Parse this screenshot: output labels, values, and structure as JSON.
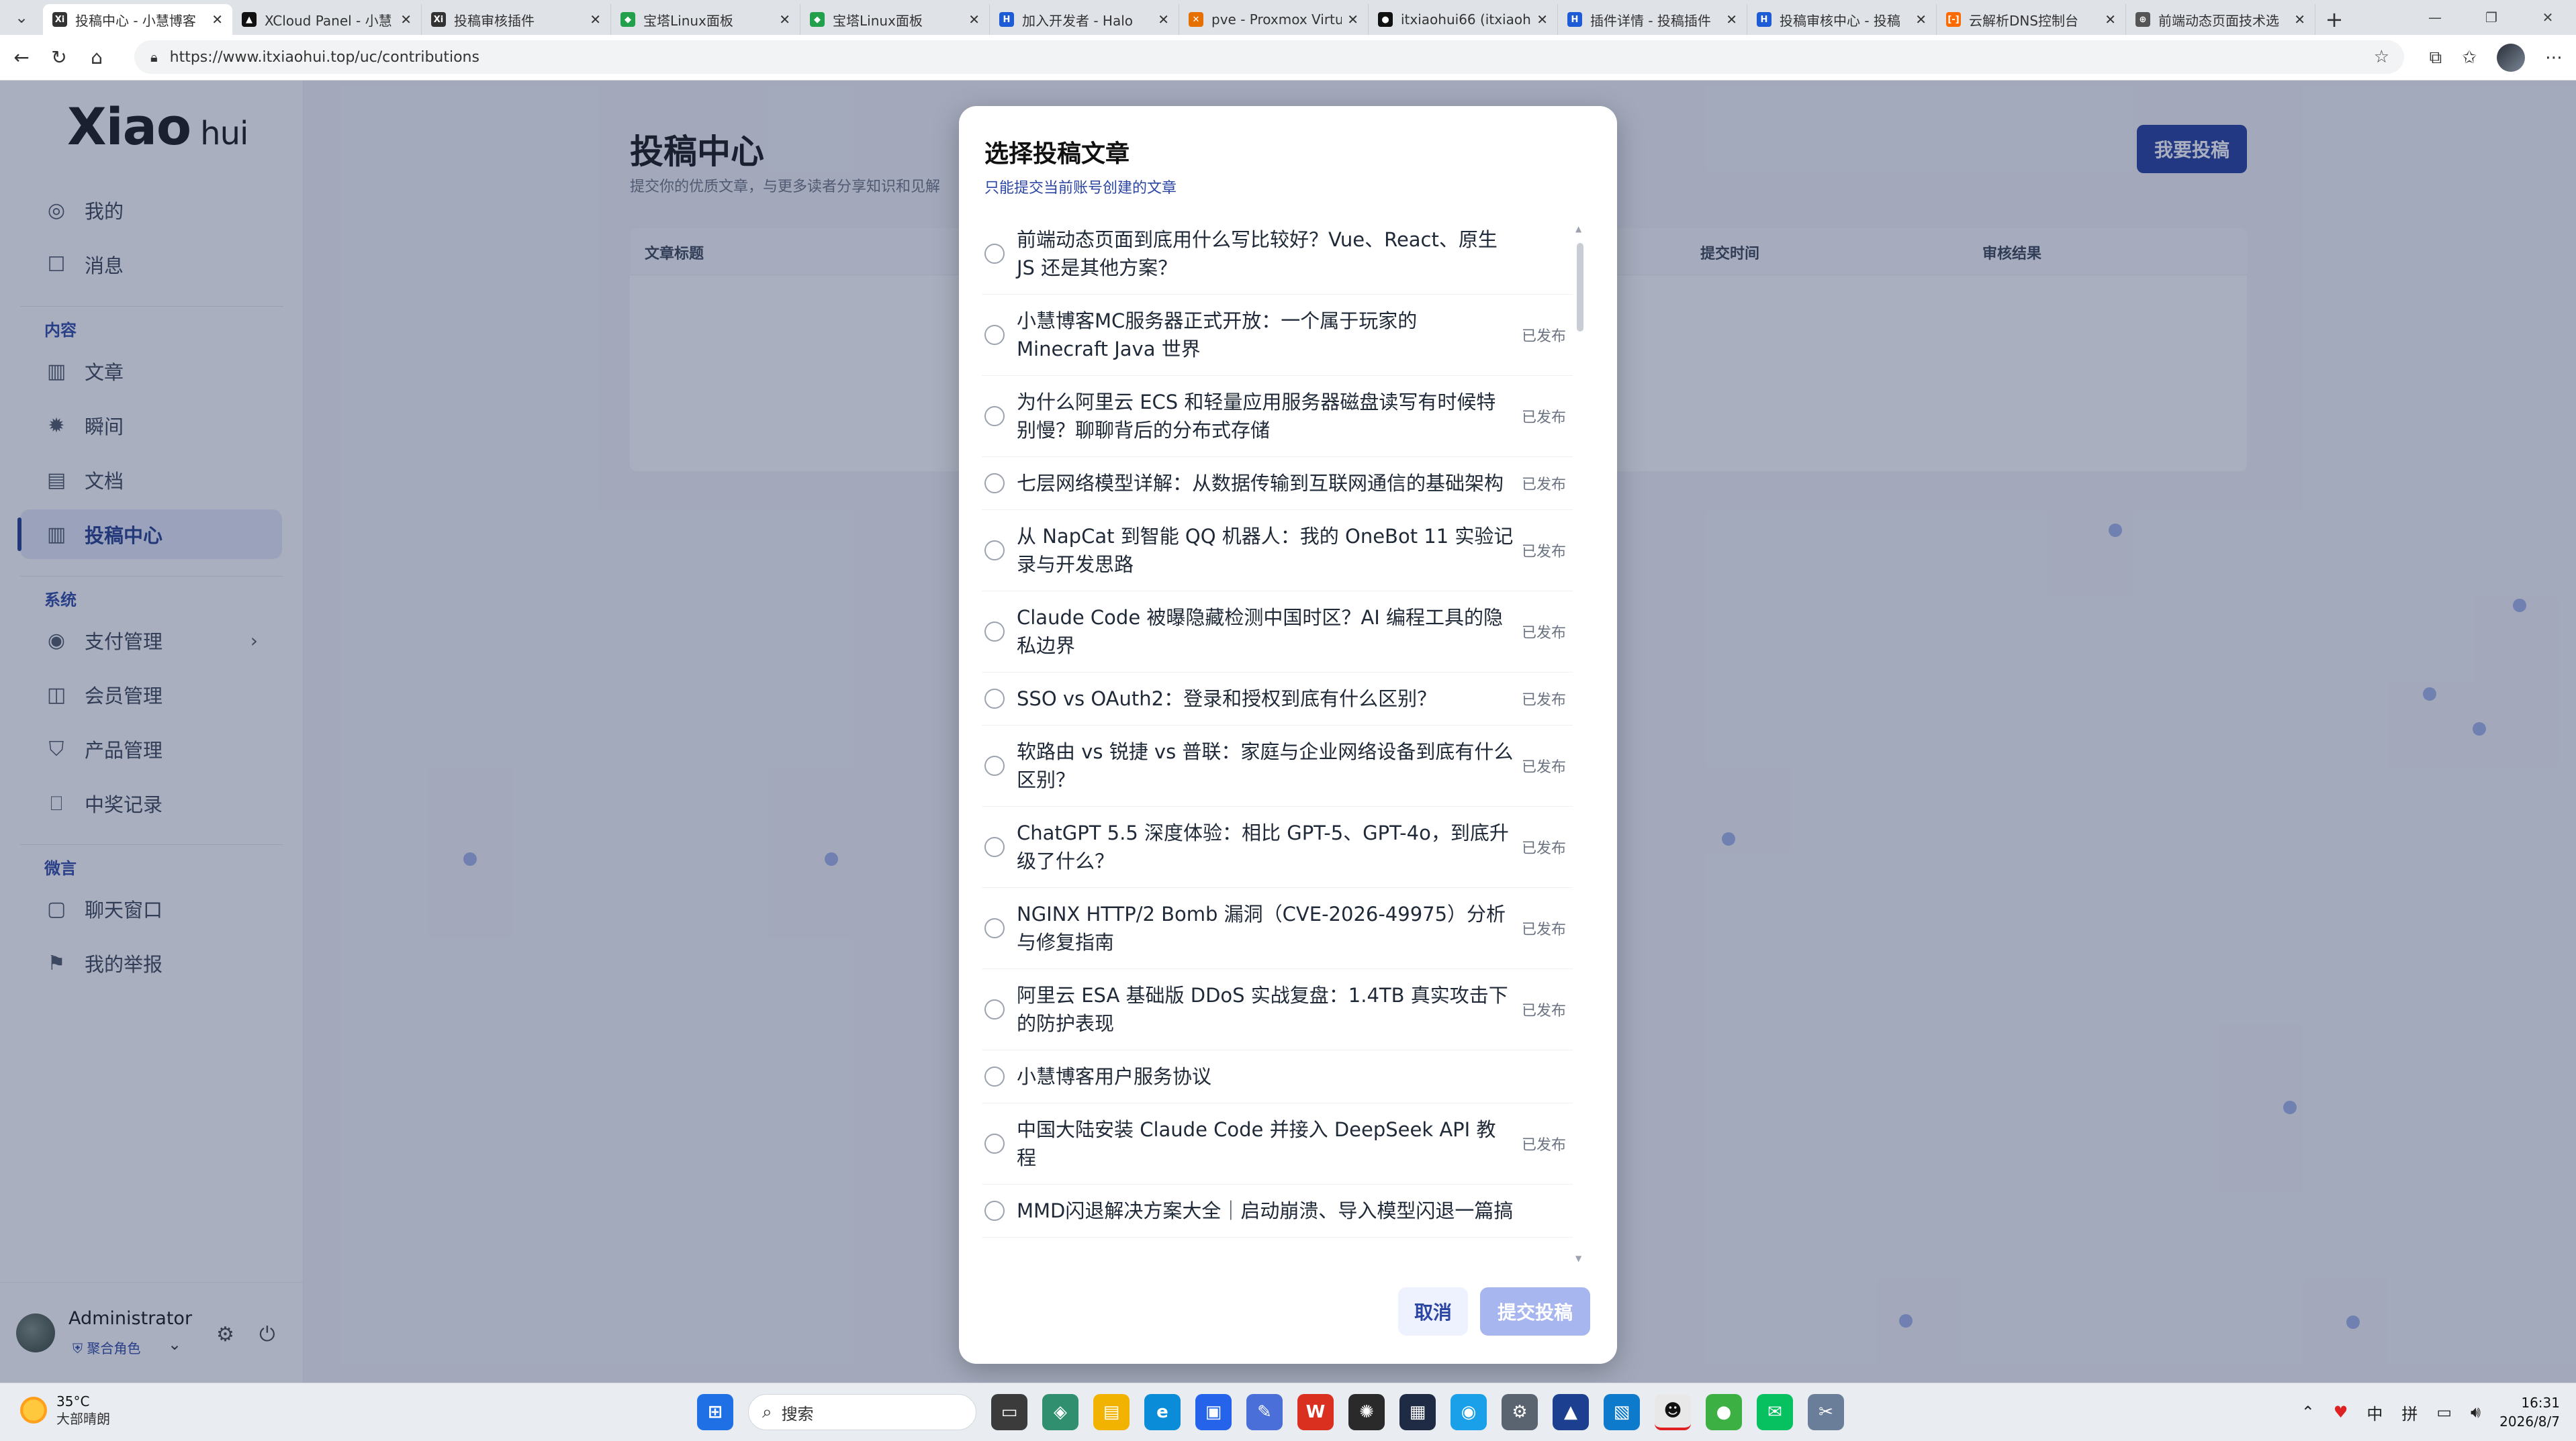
{
  "browser": {
    "tabs": [
      {
        "title": "投稿中心 - 小慧博客",
        "color": "#333333",
        "glyph": "Xi"
      },
      {
        "title": "XCloud Panel - 小慧",
        "color": "#111111",
        "glyph": "▲"
      },
      {
        "title": "投稿审核插件",
        "color": "#333333",
        "glyph": "Xi"
      },
      {
        "title": "宝塔Linux面板",
        "color": "#22a04b",
        "glyph": "◆"
      },
      {
        "title": "宝塔Linux面板",
        "color": "#22a04b",
        "glyph": "◆"
      },
      {
        "title": "加入开发者 - Halo",
        "color": "#1e5bd6",
        "glyph": "H"
      },
      {
        "title": "pve - Proxmox Virtu",
        "color": "#e57000",
        "glyph": "✕"
      },
      {
        "title": "itxiaohui66 (itxiaoh",
        "color": "#111111",
        "glyph": "●"
      },
      {
        "title": "插件详情 - 投稿插件",
        "color": "#1e5bd6",
        "glyph": "H"
      },
      {
        "title": "投稿审核中心 - 投稿",
        "color": "#1e5bd6",
        "glyph": "H"
      },
      {
        "title": "云解析DNS控制台",
        "color": "#ff6a00",
        "glyph": "[-]"
      },
      {
        "title": "前端动态页面技术选",
        "color": "#555555",
        "glyph": "⊕"
      }
    ],
    "url": "https://www.itxiaohui.top/uc/contributions"
  },
  "sidebar": {
    "logo_main": "Xiao",
    "logo_sub": "hui",
    "top_items": [
      {
        "label": "我的",
        "icon": "user-circle-icon"
      },
      {
        "label": "消息",
        "icon": "message-icon"
      }
    ],
    "section_content": "内容",
    "content_items": [
      {
        "label": "文章",
        "icon": "article-icon"
      },
      {
        "label": "瞬间",
        "icon": "moments-icon"
      },
      {
        "label": "文档",
        "icon": "document-icon"
      },
      {
        "label": "投稿中心",
        "icon": "contribution-icon",
        "active": true
      }
    ],
    "section_system": "系统",
    "system_items": [
      {
        "label": "支付管理",
        "icon": "payment-icon"
      },
      {
        "label": "会员管理",
        "icon": "member-icon"
      },
      {
        "label": "产品管理",
        "icon": "product-icon"
      },
      {
        "label": "中奖记录",
        "icon": "gift-icon"
      }
    ],
    "section_wechat": "微言",
    "wechat_items": [
      {
        "label": "聊天窗口",
        "icon": "chat-icon"
      },
      {
        "label": "我的举报",
        "icon": "flag-icon"
      }
    ],
    "user": {
      "name": "Administrator",
      "role": "聚合角色"
    }
  },
  "main": {
    "title": "投稿中心",
    "subtitle": "提交你的优质文章，与更多读者分享知识和见解",
    "submit_button": "我要投稿",
    "columns": [
      "文章标题",
      "提交时间",
      "审核结果"
    ]
  },
  "modal": {
    "title": "选择投稿文章",
    "subtitle": "只能提交当前账号创建的文章",
    "articles": [
      {
        "title": "前端动态页面到底用什么写比较好？Vue、React、原生 JS 还是其他方案？",
        "status": ""
      },
      {
        "title": "小慧博客MC服务器正式开放：一个属于玩家的 Minecraft Java 世界",
        "status": "已发布"
      },
      {
        "title": "为什么阿里云 ECS 和轻量应用服务器磁盘读写有时候特别慢？聊聊背后的分布式存储",
        "status": "已发布"
      },
      {
        "title": "七层网络模型详解：从数据传输到互联网通信的基础架构",
        "status": "已发布"
      },
      {
        "title": "从 NapCat 到智能 QQ 机器人：我的 OneBot 11 实验记录与开发思路",
        "status": "已发布"
      },
      {
        "title": "Claude Code 被曝隐藏检测中国时区？AI 编程工具的隐私边界",
        "status": "已发布"
      },
      {
        "title": "SSO vs OAuth2：登录和授权到底有什么区别？",
        "status": "已发布"
      },
      {
        "title": "软路由 vs 锐捷 vs 普联：家庭与企业网络设备到底有什么区别？",
        "status": "已发布"
      },
      {
        "title": "ChatGPT 5.5 深度体验：相比 GPT-5、GPT-4o，到底升级了什么？",
        "status": "已发布"
      },
      {
        "title": "NGINX HTTP/2 Bomb 漏洞（CVE-2026-49975）分析与修复指南",
        "status": "已发布"
      },
      {
        "title": "阿里云 ESA 基础版 DDoS 实战复盘：1.4TB 真实攻击下的防护表现",
        "status": "已发布"
      },
      {
        "title": "小慧博客用户服务协议",
        "status": ""
      },
      {
        "title": "中国大陆安装 Claude Code 并接入 DeepSeek API 教程",
        "status": "已发布"
      },
      {
        "title": "MMD闪退解决方案大全｜启动崩溃、导入模型闪退一篇搞",
        "status": ""
      }
    ],
    "cancel": "取消",
    "confirm": "提交投稿"
  },
  "taskbar": {
    "weather_temp": "35°C",
    "weather_desc": "大部晴朗",
    "search_placeholder": "搜索",
    "ime_lang": "中",
    "ime_mode": "拼",
    "time": "16:31",
    "date": "2026/8/7"
  }
}
